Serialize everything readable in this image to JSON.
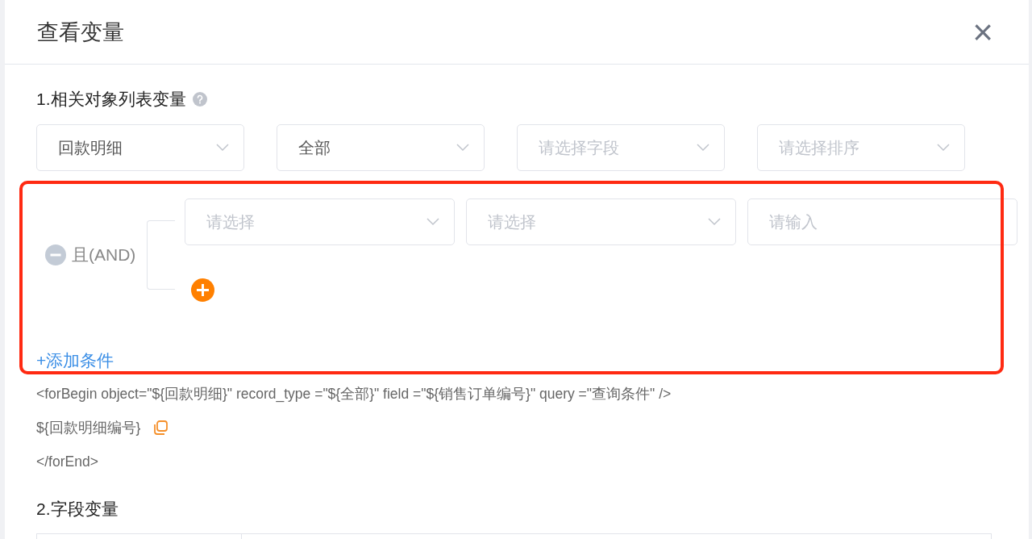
{
  "dialog": {
    "title": "查看变量",
    "close": "×"
  },
  "section_1": {
    "title": "1.相关对象列表变量",
    "selects": [
      {
        "value": "回款明细"
      },
      {
        "value": "全部"
      },
      {
        "placeholder": "请选择字段"
      },
      {
        "placeholder": "请选择排序"
      }
    ],
    "condition_group": {
      "operator": "且(AND)",
      "fields": [
        {
          "placeholder": "请选择",
          "kind": "select"
        },
        {
          "placeholder": "请选择",
          "kind": "select"
        },
        {
          "placeholder": "请输入",
          "kind": "input"
        }
      ]
    },
    "add_condition": "+添加条件",
    "code_lines": [
      {
        "text": "<forBegin object=\"${回款明细}\" record_type =\"${全部}\" field =\"${销售订单编号}\" query =\"查询条件\" />",
        "copyable": false
      },
      {
        "text": "${回款明细编号}",
        "copyable": true
      },
      {
        "text": "</forEnd>",
        "copyable": false
      }
    ]
  },
  "section_2": {
    "title": "2.字段变量"
  }
}
